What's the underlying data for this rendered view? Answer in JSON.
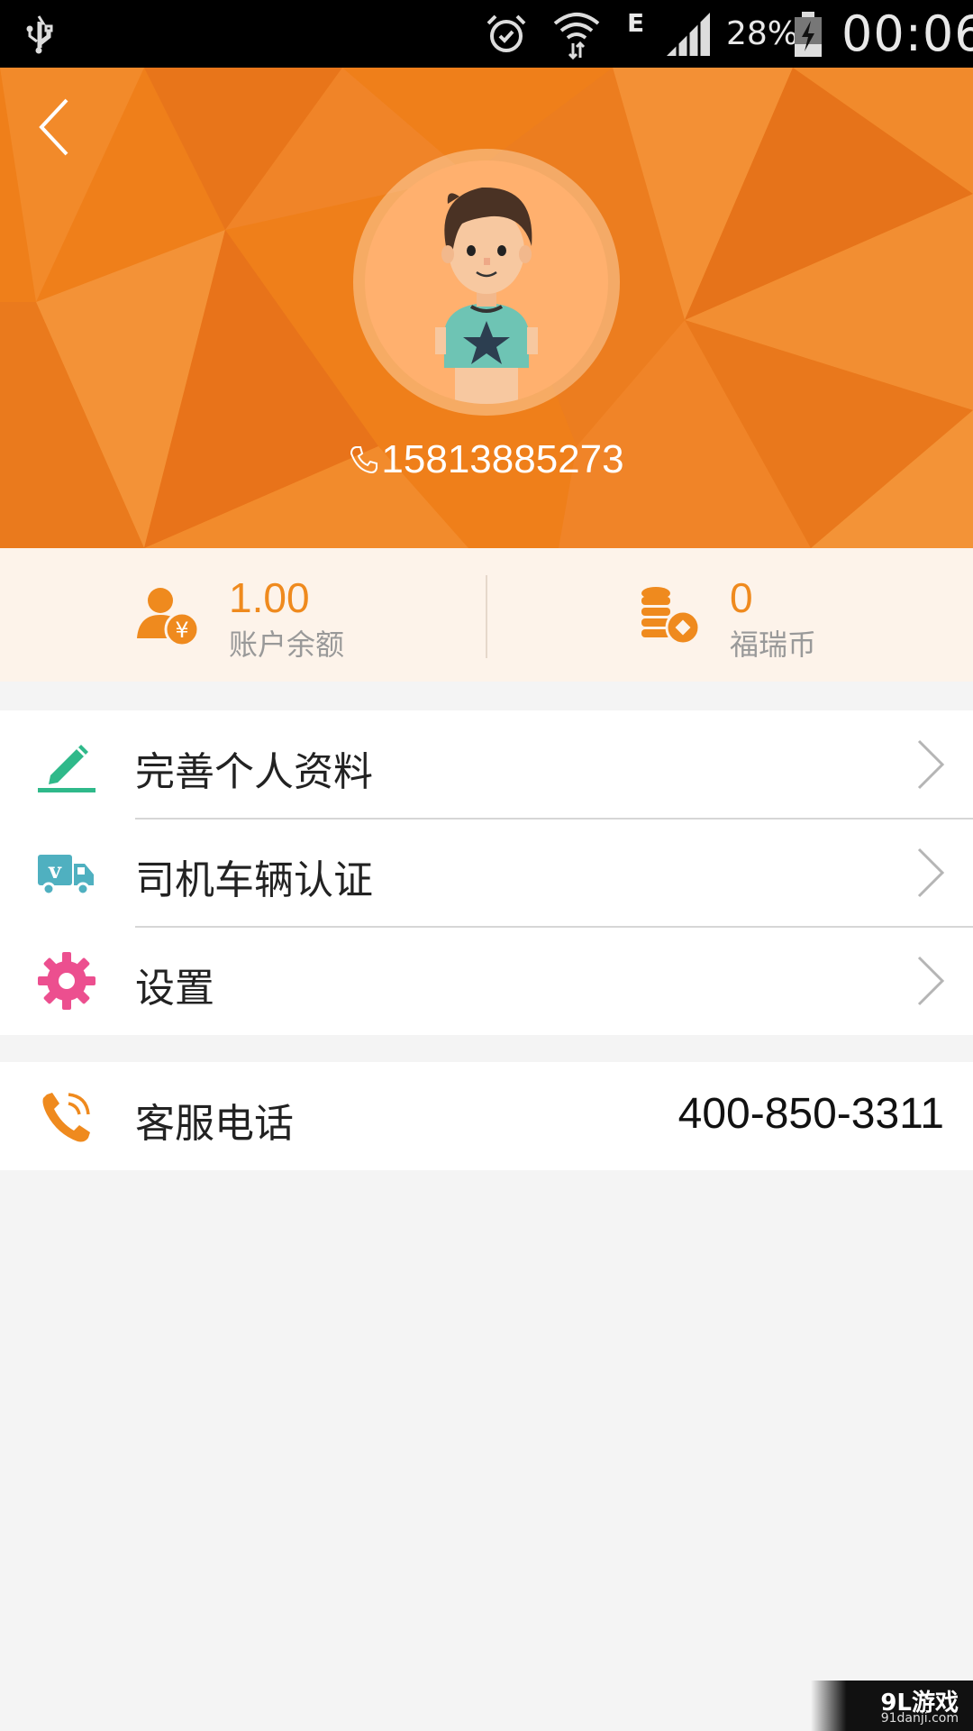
{
  "status_bar": {
    "network_type": "E",
    "battery": "28%",
    "time": "00:06"
  },
  "profile": {
    "phone": "15813885273"
  },
  "stats": {
    "balance_value": "1.00",
    "balance_label": "账户余额",
    "coin_value": "0",
    "coin_label": "福瑞币"
  },
  "menu": {
    "items": [
      {
        "label": "完善个人资料",
        "icon": "pencil-icon"
      },
      {
        "label": "司机车辆认证",
        "icon": "truck-icon"
      },
      {
        "label": "设置",
        "icon": "gear-icon"
      }
    ]
  },
  "service": {
    "label": "客服电话",
    "phone": "400-850-3311"
  },
  "watermark": {
    "brand": "9L游戏",
    "site": "91danji.com"
  },
  "colors": {
    "header_orange": "#ef7f1a",
    "accent_orange": "#ef8a1e",
    "pencil_green": "#2fb98a",
    "truck_teal": "#4fb0c0",
    "gear_pink": "#ec4f8f"
  }
}
